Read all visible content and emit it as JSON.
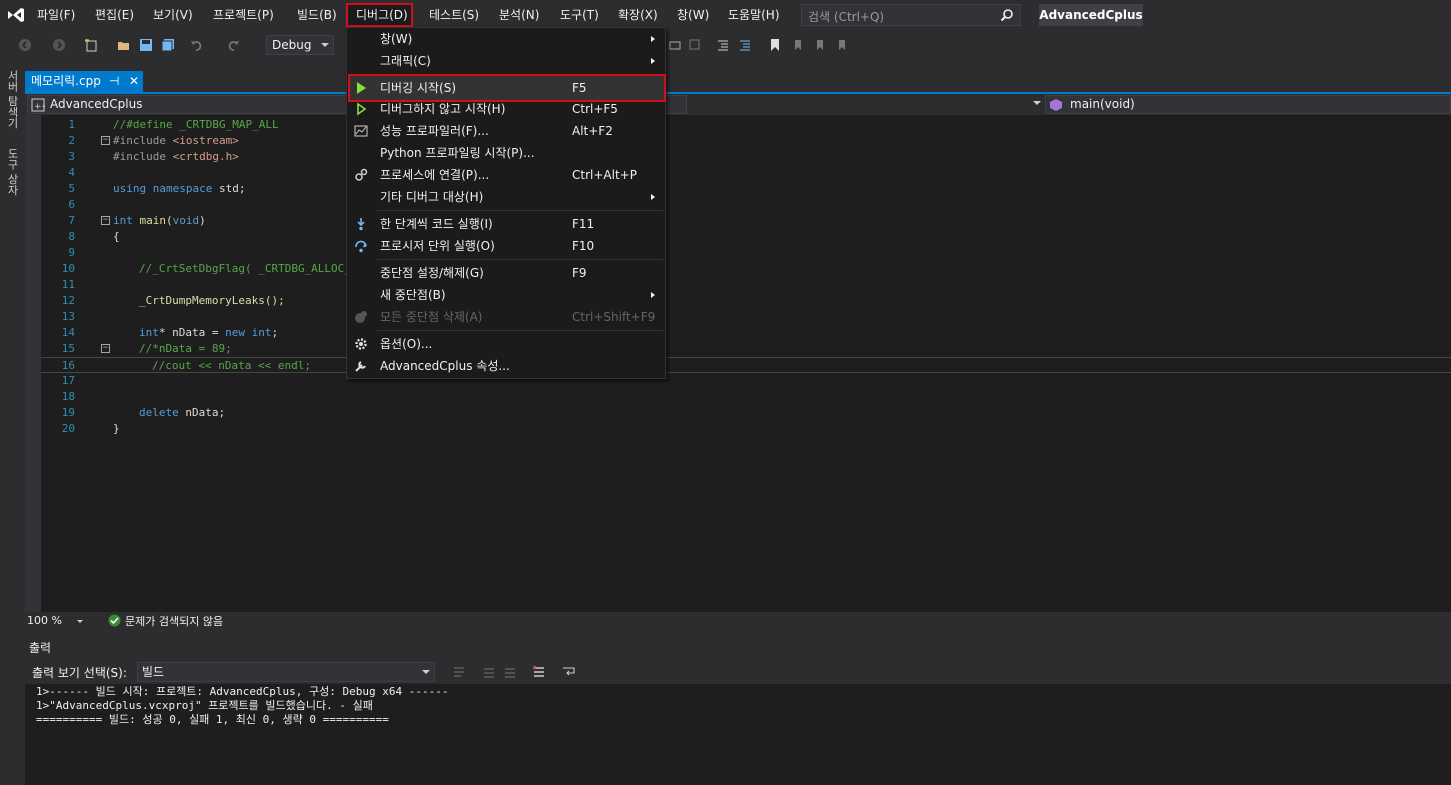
{
  "menubar": {
    "items": [
      "파일(F)",
      "편집(E)",
      "보기(V)",
      "프로젝트(P)",
      "빌드(B)",
      "디버그(D)",
      "테스트(S)",
      "분석(N)",
      "도구(T)",
      "확장(X)",
      "창(W)",
      "도움말(H)"
    ],
    "search_placeholder": "검색 (Ctrl+Q)",
    "app_title": "AdvancedCplus"
  },
  "toolbar": {
    "config": "Debug"
  },
  "sidebar": {
    "server_explorer": "서버 탐색기",
    "toolbox": "도구 상자"
  },
  "tab": {
    "filename": "메모리릭.cpp",
    "pin": "⊣",
    "close": "✕"
  },
  "navbar": {
    "project": "AdvancedCplus",
    "function": "main(void)"
  },
  "editor": {
    "line_numbers": [
      "1",
      "2",
      "3",
      "4",
      "5",
      "6",
      "7",
      "8",
      "9",
      "10",
      "11",
      "12",
      "13",
      "14",
      "15",
      "16",
      "17",
      "18",
      "19",
      "20"
    ],
    "lines": {
      "l1": "//#define _CRTDBG_MAP_ALL",
      "l2_pre": "#include ",
      "l2_str": "<iostream>",
      "l3_pre": "#include ",
      "l3_str": "<crtdbg.h>",
      "l5_kw1": "using",
      "l5_kw2": "namespace",
      "l5_rest": " std;",
      "l7_kw": "int",
      "l7_fn": " main(",
      "l7_kw2": "void",
      "l7_end": ")",
      "l8": "{",
      "l10": "//_CrtSetDbgFlag( _CRTDBG_ALLOC_M",
      "l12": "_CrtDumpMemoryLeaks();",
      "l14_kw": "int",
      "l14_mid": "* nData = ",
      "l14_kw2": "new",
      "l14_kw3": " int",
      "l14_end": ";",
      "l15": "//*nData = 89;",
      "l16": "//cout << nData << endl;",
      "l19_kw": "delete",
      "l19_rest": " nData;",
      "l20": "}"
    }
  },
  "status": {
    "zoom": "100 %",
    "issues": "문제가 검색되지 않음"
  },
  "output": {
    "title": "출력",
    "show_from_label": "출력 보기 선택(S):",
    "source": "빌드",
    "lines": [
      "1>------ 빌드 시작: 프로젝트: AdvancedCplus, 구성: Debug x64 ------",
      "1>\"AdvancedCplus.vcxproj\" 프로젝트를 빌드했습니다. - 실패",
      "========== 빌드: 성공 0, 실패 1, 최신 0, 생략 0 =========="
    ]
  },
  "debug_menu": {
    "window": "창(W)",
    "graphics": "그래픽(C)",
    "start_debugging": "디버깅 시작(S)",
    "start_debugging_shortcut": "F5",
    "start_without": "디버그하지 않고 시작(H)",
    "start_without_shortcut": "Ctrl+F5",
    "profiler": "성능 프로파일러(F)...",
    "profiler_shortcut": "Alt+F2",
    "python_profiling": "Python 프로파일링 시작(P)...",
    "attach": "프로세스에 연결(P)...",
    "attach_shortcut": "Ctrl+Alt+P",
    "other_targets": "기타 디버그 대상(H)",
    "step_into": "한 단계씩 코드 실행(I)",
    "step_into_shortcut": "F11",
    "step_over": "프로시저 단위 실행(O)",
    "step_over_shortcut": "F10",
    "toggle_bp": "중단점 설정/해제(G)",
    "toggle_bp_shortcut": "F9",
    "new_bp": "새 중단점(B)",
    "delete_all_bp": "모든 중단점 삭제(A)",
    "delete_all_bp_shortcut": "Ctrl+Shift+F9",
    "options": "옵션(O)...",
    "properties": "AdvancedCplus 속성..."
  },
  "colors": {
    "accent": "#007acc",
    "highlight_border": "#d0111b",
    "play_green": "#8ddd3b"
  }
}
